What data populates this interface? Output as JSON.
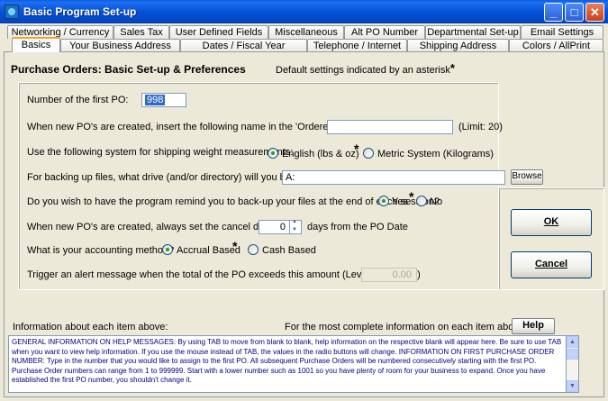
{
  "window": {
    "title": "Basic Program Set-up",
    "min_label": "_",
    "max_label": "□",
    "close_label": "✕"
  },
  "tabs_row1": [
    "Networking / Currency",
    "Sales Tax",
    "User Defined Fields",
    "Miscellaneous",
    "Alt PO Number",
    "Departmental Set-up",
    "Email Settings"
  ],
  "tabs_row2": [
    "Basics",
    "Your Business Address",
    "Dates / Fiscal Year",
    "Telephone / Internet",
    "Shipping Address",
    "Colors / AllPrint"
  ],
  "active_tab": "Basics",
  "page": {
    "heading": "Purchase Orders: Basic Set-up & Preferences",
    "default_note": "Default settings indicated by an asterisk",
    "asterisk": "*"
  },
  "form": {
    "first_po": {
      "label": "Number of the first PO:",
      "value": "998"
    },
    "ordered_by": {
      "label": "When new PO's are created, insert the following name in the 'Ordered by' blank:",
      "value": "",
      "limit": "(Limit: 20)"
    },
    "shipping_weight": {
      "label": "Use the following system for shipping weight measurements:",
      "option1": "English (lbs & oz)",
      "option2": "Metric System (Kilograms)",
      "selected": "English (lbs & oz)"
    },
    "backup_drive": {
      "label": "For backing up files, what drive (and/or directory) will you be using?",
      "value": "A:",
      "browse_label": "Browse"
    },
    "backup_remind": {
      "label": "Do you wish to have the program remind you to back-up your files at the end of each session?",
      "yes": "Yes",
      "no": "No",
      "selected": "Yes"
    },
    "cancel_date": {
      "label_before": "When new PO's are created, always set the cancel date at",
      "value": "0",
      "label_after": "days from the PO Date"
    },
    "accounting": {
      "label": "What is your accounting method?",
      "option1": "Accrual Based",
      "option2": "Cash Based",
      "selected": "Accrual Based"
    },
    "alert": {
      "label": "Trigger an alert message when the total of the PO exceeds this amount (Level III Feature)",
      "value": "0.00"
    }
  },
  "buttons": {
    "ok": "OK",
    "cancel": "Cancel",
    "help": "Help"
  },
  "help": {
    "info_label": "Information about each item above:",
    "complete_info_label": "For the most complete information on each item above, click:",
    "text": "GENERAL INFORMATION ON HELP MESSAGES: By using TAB to move from blank to blank, help information on the respective blank will appear here.  Be sure to use TAB when you want to view help information. If you use the mouse instead of TAB, the values in the radio buttons will change. INFORMATION ON FIRST PURCHASE ORDER NUMBER: Type in the number that you would like to assign to the first PO.  All subsequent Purchase Orders will be numbered consecutively starting with the first PO.  Purchase Order numbers can range from 1 to 999999. Start with a lower number such as 1001 so you have plenty of room for your business to expand. Once you have established the first PO number, you shouldn't change it."
  }
}
